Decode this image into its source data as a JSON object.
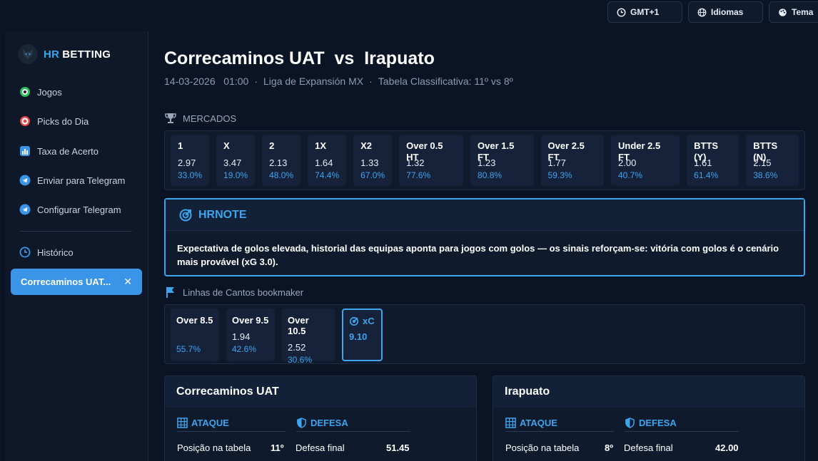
{
  "topbar": {
    "timezone": "GMT+1",
    "languages": "Idiomas",
    "theme": "Tema"
  },
  "sidebar": {
    "brand_hr": "HR",
    "brand_betting": "BETTING",
    "items": [
      {
        "label": "Jogos",
        "icon": "soccer-ball-icon"
      },
      {
        "label": "Picks do Dia",
        "icon": "target-icon"
      },
      {
        "label": "Taxa de Acerto",
        "icon": "bar-chart-icon"
      },
      {
        "label": "Enviar para Telegram",
        "icon": "telegram-icon"
      },
      {
        "label": "Configurar Telegram",
        "icon": "telegram-icon"
      },
      {
        "label": "Histórico",
        "icon": "clock-icon"
      }
    ],
    "active_item": "Correcaminos UAT..."
  },
  "match": {
    "home": "Correcaminos UAT",
    "vs": "vs",
    "away": "Irapuato",
    "date": "14-03-2026",
    "time": "01:00",
    "league": "Liga de Expansión MX",
    "table": "Tabela Classificativa: 11º vs 8º"
  },
  "markets": {
    "label": "MERCADOS",
    "items": [
      {
        "label": "1",
        "odd": "2.97",
        "pct": "33.0%"
      },
      {
        "label": "X",
        "odd": "3.47",
        "pct": "19.0%"
      },
      {
        "label": "2",
        "odd": "2.13",
        "pct": "48.0%"
      },
      {
        "label": "1X",
        "odd": "1.64",
        "pct": "74.4%"
      },
      {
        "label": "X2",
        "odd": "1.33",
        "pct": "67.0%"
      },
      {
        "label": "Over 0.5 HT",
        "odd": "1.32",
        "pct": "77.6%"
      },
      {
        "label": "Over 1.5 FT",
        "odd": "1.23",
        "pct": "80.8%"
      },
      {
        "label": "Over 2.5 FT",
        "odd": "1.77",
        "pct": "59.3%"
      },
      {
        "label": "Under 2.5 FT",
        "odd": "2.00",
        "pct": "40.7%"
      },
      {
        "label": "BTTS (Y)",
        "odd": "1.61",
        "pct": "61.4%"
      },
      {
        "label": "BTTS (N)",
        "odd": "2.15",
        "pct": "38.6%"
      }
    ]
  },
  "hrnote": {
    "title": "HRNOTE",
    "text": "Expectativa de golos elevada, historial das equipas aponta para jogos com golos — os sinais reforçam-se: vitória com golos é o cenário mais provável (xG 3.0)."
  },
  "corners": {
    "label": "Linhas de Cantos bookmaker",
    "items": [
      {
        "label": "Over 8.5",
        "odd": "",
        "pct": "55.7%"
      },
      {
        "label": "Over 9.5",
        "odd": "1.94",
        "pct": "42.6%"
      },
      {
        "label": "Over 10.5",
        "odd": "2.52",
        "pct": "30.6%"
      }
    ],
    "xc_label": "xC",
    "xc_value": "9.10"
  },
  "teams": [
    {
      "name": "Correcaminos UAT",
      "attack_label": "ATAQUE",
      "defense_label": "DEFESA",
      "attack_row_label": "Posição na tabela",
      "attack_row_value": "11º",
      "defense_row_label": "Defesa final",
      "defense_row_value": "51.45"
    },
    {
      "name": "Irapuato",
      "attack_label": "ATAQUE",
      "defense_label": "DEFESA",
      "attack_row_label": "Posição na tabela",
      "attack_row_value": "8º",
      "defense_row_label": "Defesa final",
      "defense_row_value": "42.00"
    }
  ],
  "colors": {
    "accent": "#3ea4ee",
    "background": "#0b1424",
    "panel": "#0f1a2d",
    "card": "#16223a"
  }
}
